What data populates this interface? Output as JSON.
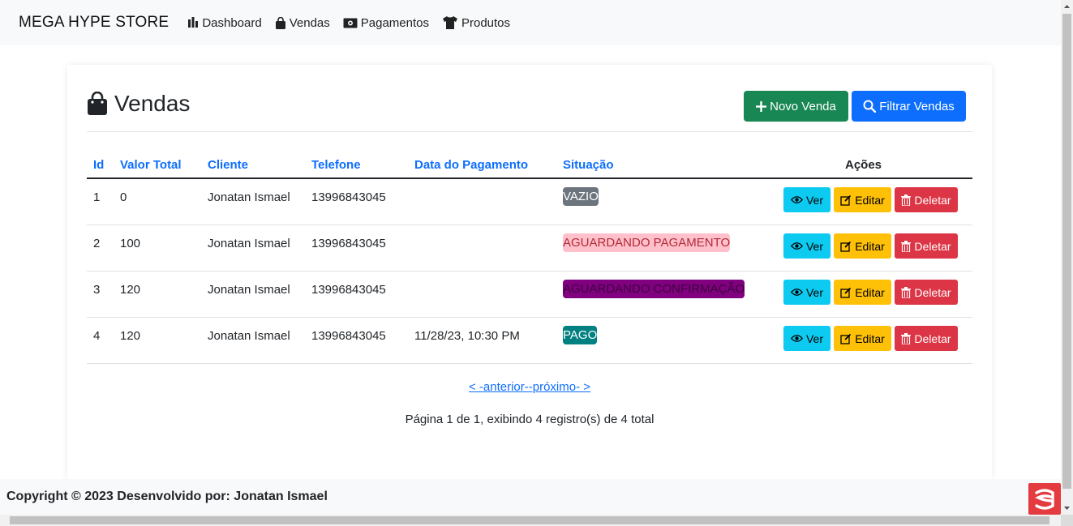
{
  "navbar": {
    "brand": "MEGA HYPE STORE",
    "items": [
      {
        "label": "Dashboard",
        "icon": "bar-chart-icon"
      },
      {
        "label": "Vendas",
        "icon": "shopping-bag-icon"
      },
      {
        "label": "Pagamentos",
        "icon": "cash-icon"
      },
      {
        "label": "Produtos",
        "icon": "tshirt-icon"
      }
    ]
  },
  "page": {
    "title": "Vendas",
    "new_button": "Novo Venda",
    "filter_button": "Filtrar Vendas"
  },
  "table": {
    "headers": [
      "Id",
      "Valor Total",
      "Cliente",
      "Telefone",
      "Data do Pagamento",
      "Situação",
      "Ações"
    ],
    "rows": [
      {
        "id": "1",
        "total": "0",
        "cliente": "Jonatan Ismael",
        "telefone": "13996843045",
        "data": "",
        "situacao": "VAZIO",
        "badge_bg": "#6c757d",
        "badge_fg": "#ffffff"
      },
      {
        "id": "2",
        "total": "100",
        "cliente": "Jonatan Ismael",
        "telefone": "13996843045",
        "data": "",
        "situacao": "AGUARDANDO PAGAMENTO",
        "badge_bg": "#ffc0cb",
        "badge_fg": "#b02a37"
      },
      {
        "id": "3",
        "total": "120",
        "cliente": "Jonatan Ismael",
        "telefone": "13996843045",
        "data": "",
        "situacao": "AGUARDANDO CONFIRMAÇÃO",
        "badge_bg": "#800080",
        "badge_fg": "#3d003d"
      },
      {
        "id": "4",
        "total": "120",
        "cliente": "Jonatan Ismael",
        "telefone": "13996843045",
        "data": "11/28/23, 10:30 PM",
        "situacao": "PAGO",
        "badge_bg": "#008080",
        "badge_fg": "#ffffff"
      }
    ],
    "actions": {
      "view": "Ver",
      "edit": "Editar",
      "delete": "Deletar"
    }
  },
  "pagination": {
    "link": "< -anterior--próximo- >",
    "info": "Página 1 de 1, exibindo 4 registro(s) de 4 total"
  },
  "footer": {
    "text": "Copyright © 2023 Desenvolvido por: Jonatan Ismael"
  },
  "colors": {
    "success": "#198754",
    "primary": "#0d6efd",
    "info": "#0dcaf0",
    "warning": "#ffc107",
    "danger": "#dc3545"
  }
}
